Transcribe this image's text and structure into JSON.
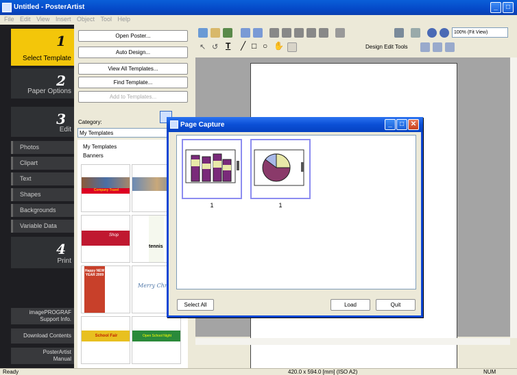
{
  "window": {
    "title": "Untitled - PosterArtist"
  },
  "menu": [
    "File",
    "Edit",
    "View",
    "Insert",
    "Object",
    "Tool",
    "Help"
  ],
  "steps": [
    {
      "num": "1",
      "label": "Select Template"
    },
    {
      "num": "2",
      "label": "Paper Options"
    },
    {
      "num": "3",
      "label": "Edit"
    },
    {
      "num": "4",
      "label": "Print"
    }
  ],
  "edit_items": [
    "Photos",
    "Clipart",
    "Text",
    "Shapes",
    "Backgrounds",
    "Variable Data"
  ],
  "bottom_links": [
    "imagePROGRAF\nSupport Info.",
    "Download Contents",
    "PosterArtist\nManual"
  ],
  "panel": {
    "open_poster": "Open Poster...",
    "auto_design": "Auto Design...",
    "view_all": "View All Templates...",
    "find_template": "Find Template...",
    "add_templates": "Add to Templates...",
    "category_label": "Category:",
    "category_value": "My Templates",
    "tree": [
      "My Templates",
      "Banners"
    ]
  },
  "thumbs": [
    {
      "caption": "Company Travel"
    },
    {
      "caption": ""
    },
    {
      "caption": "Shop"
    },
    {
      "caption": "tennis"
    },
    {
      "caption": "Happy NEW YEAR 2009"
    },
    {
      "caption": "Merry Christ"
    },
    {
      "caption": "School Fair"
    },
    {
      "caption": "Open School Night"
    }
  ],
  "toolbar": {
    "zoom": "100% (Fit View)",
    "design_edit_tools": "Design Edit Tools"
  },
  "dialog": {
    "title": "Page Capture",
    "captures": [
      {
        "type": "bar",
        "label": "1"
      },
      {
        "type": "pie",
        "label": "1"
      }
    ],
    "select_all": "Select All",
    "load": "Load",
    "quit": "Quit"
  },
  "status": {
    "left": "Ready",
    "paper": "420.0 x 594.0 [mm] (ISO A2)",
    "num": "NUM"
  },
  "colors": {
    "active_step": "#f3c60a",
    "titlebar": "#0549c8",
    "capture_border": "#8c8cf0"
  }
}
